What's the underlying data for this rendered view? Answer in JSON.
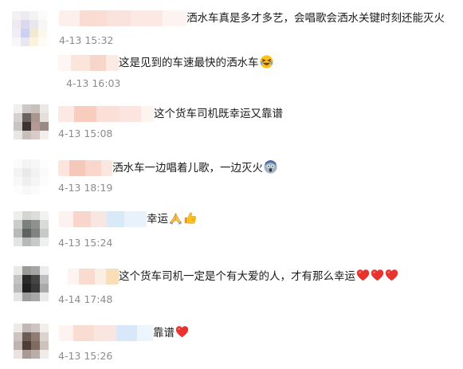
{
  "comments": [
    {
      "text": "洒水车真是多才多艺，会唱歌会洒水关键时刻还能灭火",
      "time": "4-13 15:32",
      "emojis": []
    },
    {
      "text": "这是见到的车速最快的洒水车",
      "time": "4-13 16:03",
      "emojis": [
        "laughing-tears-emoji"
      ]
    },
    {
      "text": "这个货车司机既幸运又靠谱",
      "time": "4-13 15:08",
      "emojis": []
    },
    {
      "text": "洒水车一边唱着儿歌，一边灭火",
      "time": "4-13 18:19",
      "emojis": [
        "shocked-face-emoji"
      ]
    },
    {
      "text": "幸运",
      "time": "4-13 15:24",
      "emojis": [
        "folded-hands-emoji",
        "thumbs-up-emoji"
      ]
    },
    {
      "text": "这个货车司机一定是个有大爱的人，才有那么幸运",
      "time": "4-14 17:48",
      "emojis": [
        "red-heart-emoji",
        "red-heart-emoji",
        "red-heart-emoji"
      ]
    },
    {
      "text": "靠谱",
      "time": "4-13 15:26",
      "emojis": [
        "red-heart-emoji"
      ]
    }
  ],
  "colors": {
    "text": "#1a1a1a",
    "timestamp": "#8c8c8c",
    "heart": "#e8332f",
    "emoji_yellow": "#fcc21b"
  }
}
